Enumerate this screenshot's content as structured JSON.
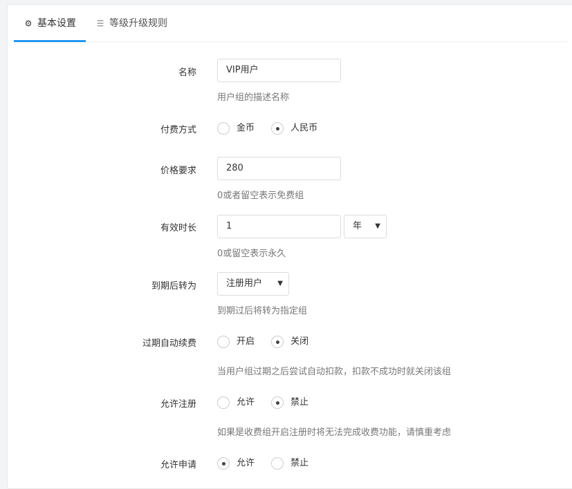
{
  "tabs": [
    {
      "label": "基本设置",
      "icon": "gear-icon",
      "active": true
    },
    {
      "label": "等级升级规则",
      "icon": "list-icon",
      "active": false
    }
  ],
  "form": {
    "name": {
      "label": "名称",
      "value": "VIP用户",
      "help": "用户组的描述名称"
    },
    "pay_method": {
      "label": "付费方式",
      "options": [
        "金币",
        "人民币"
      ],
      "selected": "人民币"
    },
    "price": {
      "label": "价格要求",
      "value": "280",
      "help": "0或者留空表示免费组"
    },
    "duration": {
      "label": "有效时长",
      "value": "1",
      "unit": "年",
      "help": "0或留空表示永久"
    },
    "expire_to": {
      "label": "到期后转为",
      "value": "注册用户",
      "help": "到期过后将转为指定组"
    },
    "auto_renew": {
      "label": "过期自动续费",
      "options": [
        "开启",
        "关闭"
      ],
      "selected": "关闭",
      "help": "当用户组过期之后尝试自动扣款，扣款不成功时就关闭该组"
    },
    "allow_register": {
      "label": "允许注册",
      "options": [
        "允许",
        "禁止"
      ],
      "selected": "禁止",
      "help": "如果是收费组开启注册时将无法完成收费功能，请慎重考虑"
    },
    "allow_apply": {
      "label": "允许申请",
      "options": [
        "允许",
        "禁止"
      ],
      "selected": "允许"
    }
  },
  "colors": {
    "accent": "#2196f3"
  }
}
